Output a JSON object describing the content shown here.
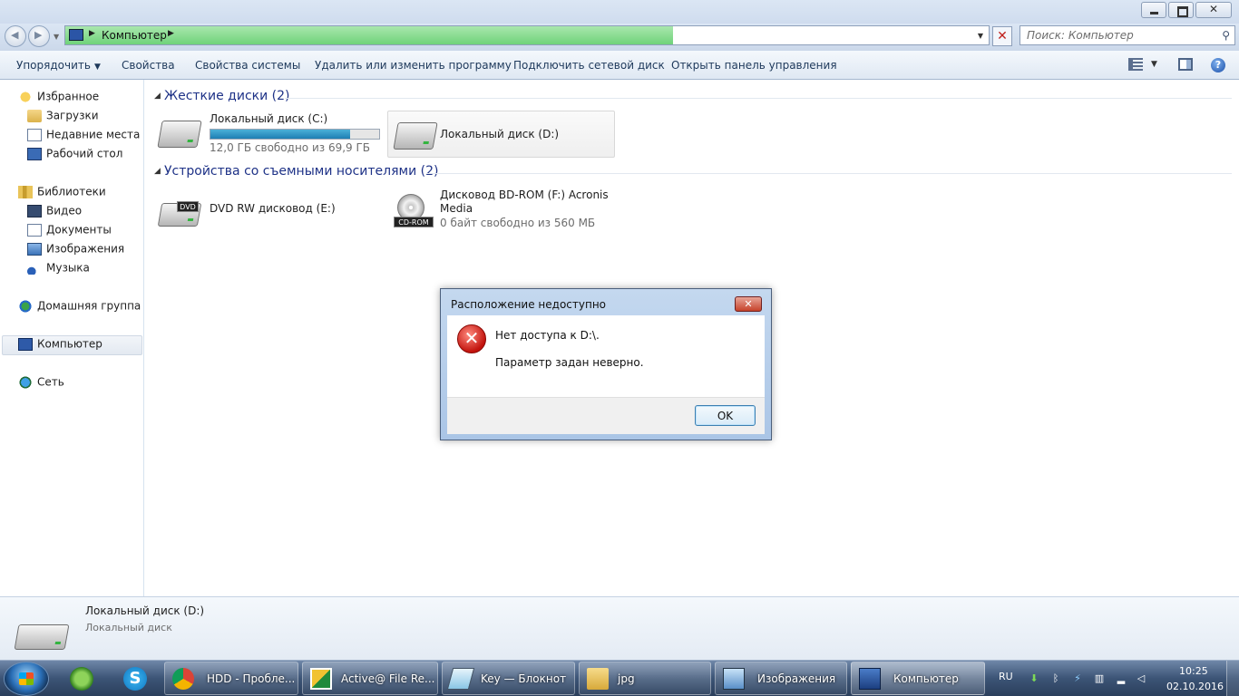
{
  "window": {
    "address": {
      "location": "Компьютер"
    },
    "search": {
      "placeholder": "Поиск: Компьютер"
    }
  },
  "toolbar": {
    "organize": "Упорядочить",
    "properties": "Свойства",
    "system_properties": "Свойства системы",
    "uninstall": "Удалить или изменить программу",
    "map_drive": "Подключить сетевой диск",
    "control_panel": "Открыть панель управления"
  },
  "sidebar": {
    "favorites": "Избранное",
    "downloads": "Загрузки",
    "recent": "Недавние места",
    "desktop": "Рабочий стол",
    "libraries": "Библиотеки",
    "video": "Видео",
    "documents": "Документы",
    "images": "Изображения",
    "music": "Музыка",
    "homegroup": "Домашняя группа",
    "computer": "Компьютер",
    "network": "Сеть"
  },
  "main": {
    "hard_disks_title": "Жесткие диски (2)",
    "removable_title": "Устройства со съемными носителями (2)",
    "drive_c": {
      "name": "Локальный диск (C:)",
      "free": "12,0 ГБ свободно из 69,9 ГБ",
      "used_fraction": 0.83
    },
    "drive_d": {
      "name": "Локальный диск (D:)"
    },
    "drive_e": {
      "name": "DVD RW дисковод (E:)",
      "badge": "DVD"
    },
    "drive_f": {
      "name_line1": "Дисковод BD-ROM (F:) Acronis",
      "name_line2": "Media",
      "free": "0 байт свободно из 560 МБ",
      "badge": "CD-ROM"
    }
  },
  "details": {
    "name": "Локальный диск (D:)",
    "type": "Локальный диск"
  },
  "dialog": {
    "title": "Расположение недоступно",
    "message1": "Нет доступа к D:\\.",
    "message2": "Параметр задан неверно.",
    "ok": "OK"
  },
  "taskbar": {
    "tasks": [
      {
        "label": "HDD - Пробле..."
      },
      {
        "label": "Active@ File Re..."
      },
      {
        "label": "Key — Блокнот"
      },
      {
        "label": "jpg"
      },
      {
        "label": "Изображения"
      },
      {
        "label": "Компьютер"
      }
    ],
    "language": "RU",
    "time": "10:25",
    "date": "02.10.2016"
  },
  "colors": {
    "group_title": "#1e3287",
    "progress_green": "#6fd37a",
    "drive_bar": "#1e7fb3",
    "error_red": "#c2130d"
  }
}
